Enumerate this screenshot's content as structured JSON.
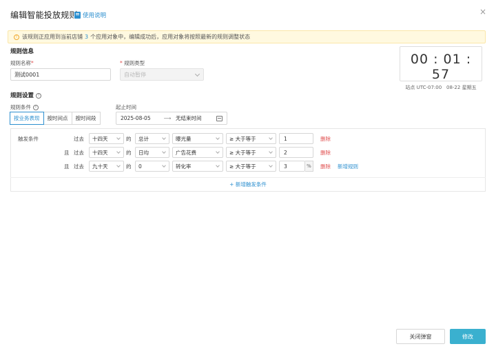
{
  "dialog": {
    "title": "编辑智能投放规则",
    "help_label": "使用说明",
    "close_glyph": "×"
  },
  "notice": {
    "prefix": "该规则正应用到当前店铺",
    "count": "3",
    "suffix": "个应用对象中，编辑成功后，应用对象将按照最新的规则调整状态"
  },
  "rule_info": {
    "section_title": "规则信息",
    "name_label": "规则名称",
    "name_value": "测试0001",
    "type_label": "规则类型",
    "type_value": "自动暂停"
  },
  "clock": {
    "time": "00 : 01 : 57",
    "zone": "站点 UTC-07:00",
    "date": "08-22 星期五"
  },
  "rule_settings": {
    "section_title": "规则设置",
    "condition_label": "规则条件",
    "condition_options": [
      "按业务表现",
      "按时间点",
      "按时间段"
    ],
    "period_label": "起止时间",
    "start_date": "2025-08-05",
    "arrow": "⟶",
    "end_date": "无结束时间"
  },
  "trigger": {
    "label": "触发条件",
    "rows": [
      {
        "prefix": "",
        "past": "过去",
        "range": "十四天",
        "of": "的",
        "agg": "总计",
        "metric": "曝光量",
        "op": "≥ 大于等于",
        "value": "1",
        "unit": "",
        "delete": "删除",
        "add": ""
      },
      {
        "prefix": "且",
        "past": "过去",
        "range": "十四天",
        "of": "的",
        "agg": "日均",
        "metric": "广告花费",
        "op": "≥ 大于等于",
        "value": "2",
        "unit": "",
        "delete": "删除",
        "add": ""
      },
      {
        "prefix": "且",
        "past": "过去",
        "range": "九十天",
        "of": "的",
        "agg": "0",
        "metric": "转化率",
        "op": "≥ 大于等于",
        "value": "3",
        "unit": "%",
        "delete": "删除",
        "add": "新增规则"
      }
    ],
    "add_condition": "+ 新增触发条件"
  },
  "footer": {
    "close_label": "关闭弹窗",
    "submit_label": "修改"
  },
  "colors": {
    "accent": "#2c8fcf",
    "primary_button": "#3ab0cf",
    "danger": "#e05050",
    "notice_bg": "#fff9e0"
  }
}
